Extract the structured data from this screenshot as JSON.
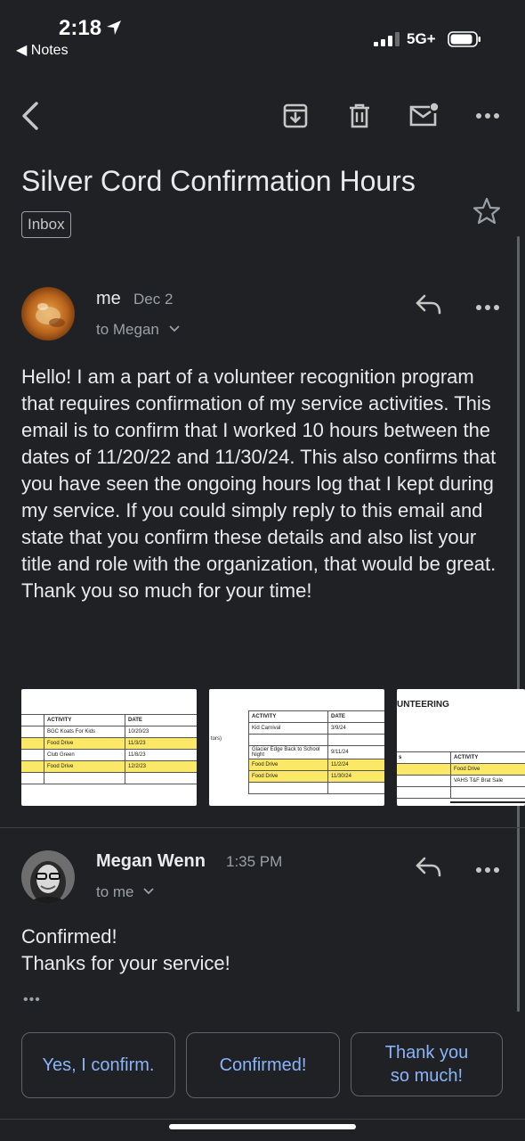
{
  "status_bar": {
    "time": "2:18",
    "back_app": "Notes",
    "network": "5G+"
  },
  "toolbar": {
    "icons": [
      "back-icon",
      "archive-icon",
      "trash-icon",
      "mark-unread-icon",
      "more-icon"
    ]
  },
  "email": {
    "subject": "Silver Cord Confirmation Hours",
    "label": "Inbox"
  },
  "message1": {
    "sender": "me",
    "date": "Dec 2",
    "recipient": "to Megan",
    "body": "Hello! I am a part of a volunteer recognition program that requires confirmation of my service activities. This email is to confirm that I worked 10 hours between the dates of 11/20/22 and 11/30/24. This also confirms that you have seen the ongoing hours log that I kept during my service. If you could simply reply to this email and state that you confirm these details and also list your title and role with the organization, that would be great. Thank you so much for your time!"
  },
  "attachments": {
    "a1": {
      "headers": [
        "ACTIVITY",
        "DATE"
      ],
      "rows": [
        {
          "activity": "BGC Koats For Kids",
          "date": "10/20/23",
          "highlight": false
        },
        {
          "activity": "Food Drive",
          "date": "11/3/23",
          "highlight": true
        },
        {
          "activity": "Club Green",
          "date": "11/8/23",
          "highlight": false
        },
        {
          "activity": "Food Drive",
          "date": "12/2/23",
          "highlight": true
        }
      ]
    },
    "a2": {
      "headers": [
        "ACTIVITY",
        "DATE"
      ],
      "side_label": "tors)",
      "rows": [
        {
          "activity": "Kid Carnival",
          "date": "3/9/24",
          "highlight": false
        },
        {
          "activity": "Glacier Edge Back to School Night",
          "date": "9/11/24",
          "highlight": false
        },
        {
          "activity": "Food Drive",
          "date": "11/2/24",
          "highlight": true
        },
        {
          "activity": "Food Drive",
          "date": "11/30/24",
          "highlight": true
        }
      ]
    },
    "a3": {
      "title": "UNTEERING",
      "left_col": "s",
      "header": "ACTIVITY",
      "rows": [
        {
          "activity": "Food Drive",
          "highlight": true
        },
        {
          "activity": "VAHS T&F Brat Sale",
          "highlight": false
        }
      ]
    }
  },
  "message2": {
    "sender": "Megan Wenn",
    "time": "1:35 PM",
    "recipient": "to me",
    "body_line1": "Confirmed!",
    "body_line2": "Thanks for your service!",
    "ellipsis": "•••"
  },
  "smart_replies": [
    "Yes, I confirm.",
    "Confirmed!",
    "Thank you so much!"
  ],
  "colors": {
    "background": "#202124",
    "accent": "#8ab4f8",
    "highlight": "#fbe866"
  }
}
